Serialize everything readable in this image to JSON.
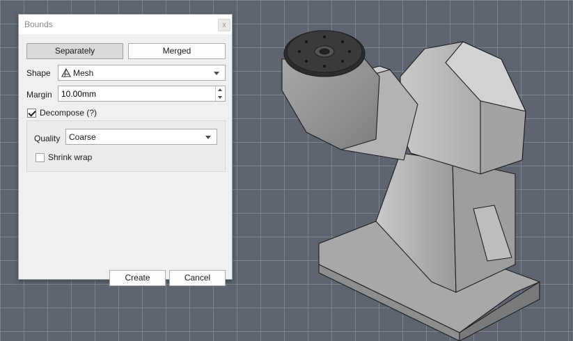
{
  "dialog": {
    "title": "Bounds",
    "close_glyph": "x",
    "mode_buttons": {
      "separately": "Separately",
      "merged": "Merged",
      "active": "separately"
    },
    "shape": {
      "label": "Shape",
      "value": "Mesh",
      "icon": "mesh-icon"
    },
    "margin": {
      "label": "Margin",
      "value": "10.00mm"
    },
    "decompose": {
      "label": "Decompose (?)",
      "checked": true
    },
    "quality": {
      "label": "Quality",
      "value": "Coarse"
    },
    "shrink_wrap": {
      "label": "Shrink wrap",
      "checked": false
    },
    "create_label": "Create",
    "cancel_label": "Cancel"
  },
  "colors": {
    "viewport_bg": "#5e6570",
    "grid_line": "#969eaa",
    "model_fill": "#b8b8b8",
    "model_edge": "#1e1e1e",
    "pressed_button": "#d9d9d9"
  }
}
